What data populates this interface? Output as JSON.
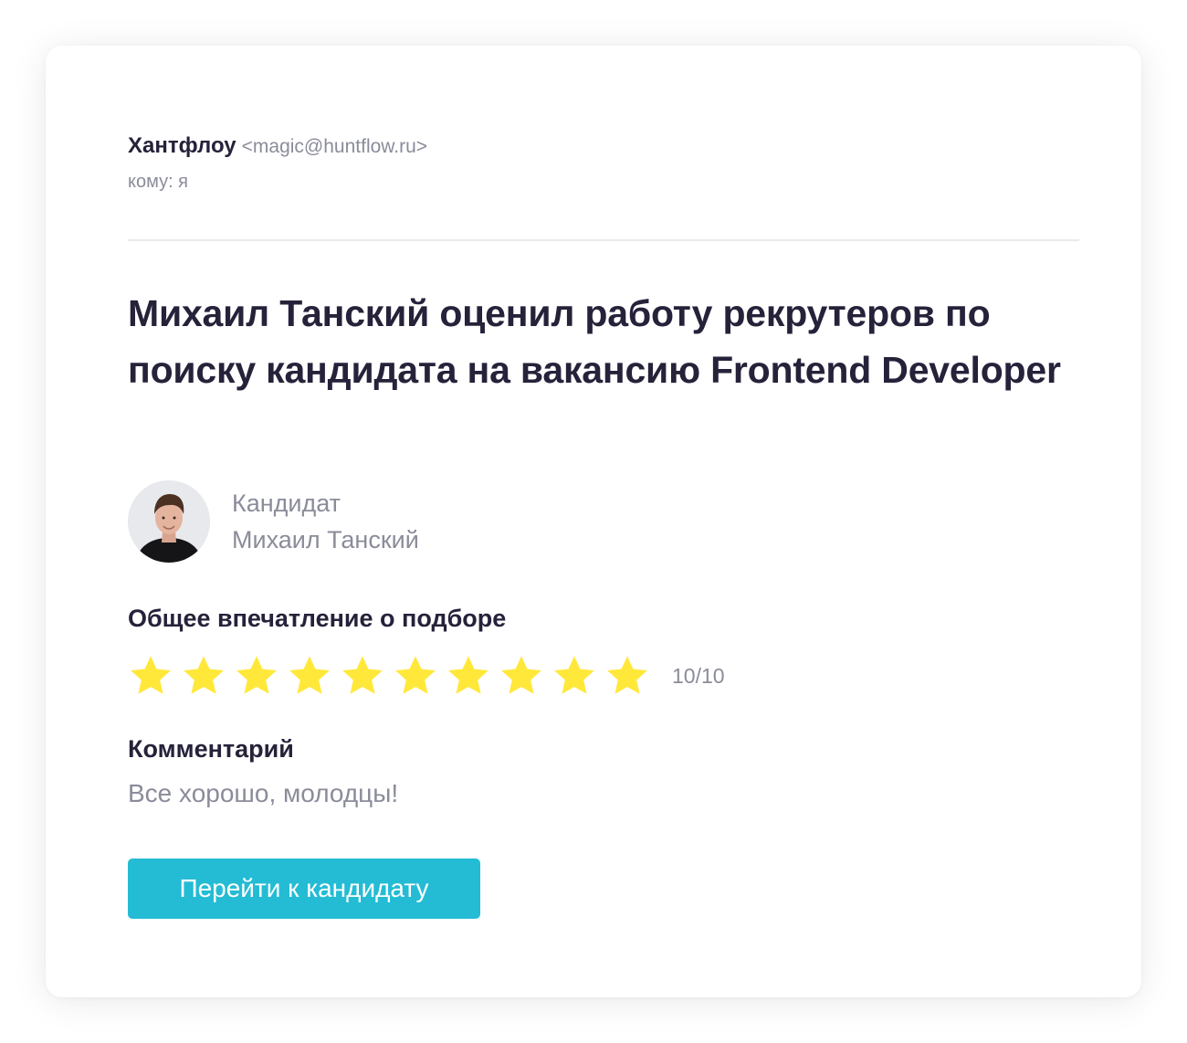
{
  "email": {
    "sender_name": "Хантфлоу",
    "sender_email": "<magic@huntflow.ru>",
    "recipient": "кому: я"
  },
  "headline": "Михаил Танский оценил работу рекрутеров по поиску кандидата на вакансию Frontend Developer",
  "candidate": {
    "role_label": "Кандидат",
    "name": "Михаил Танский"
  },
  "rating": {
    "title": "Общее впечатление о подборе",
    "value": 10,
    "max": 10,
    "score_text": "10/10",
    "star_color": "#ffe83a"
  },
  "comment": {
    "title": "Комментарий",
    "text": "Все хорошо, молодцы!"
  },
  "cta": {
    "label": "Перейти к кандидату",
    "color": "#24bcd4"
  }
}
